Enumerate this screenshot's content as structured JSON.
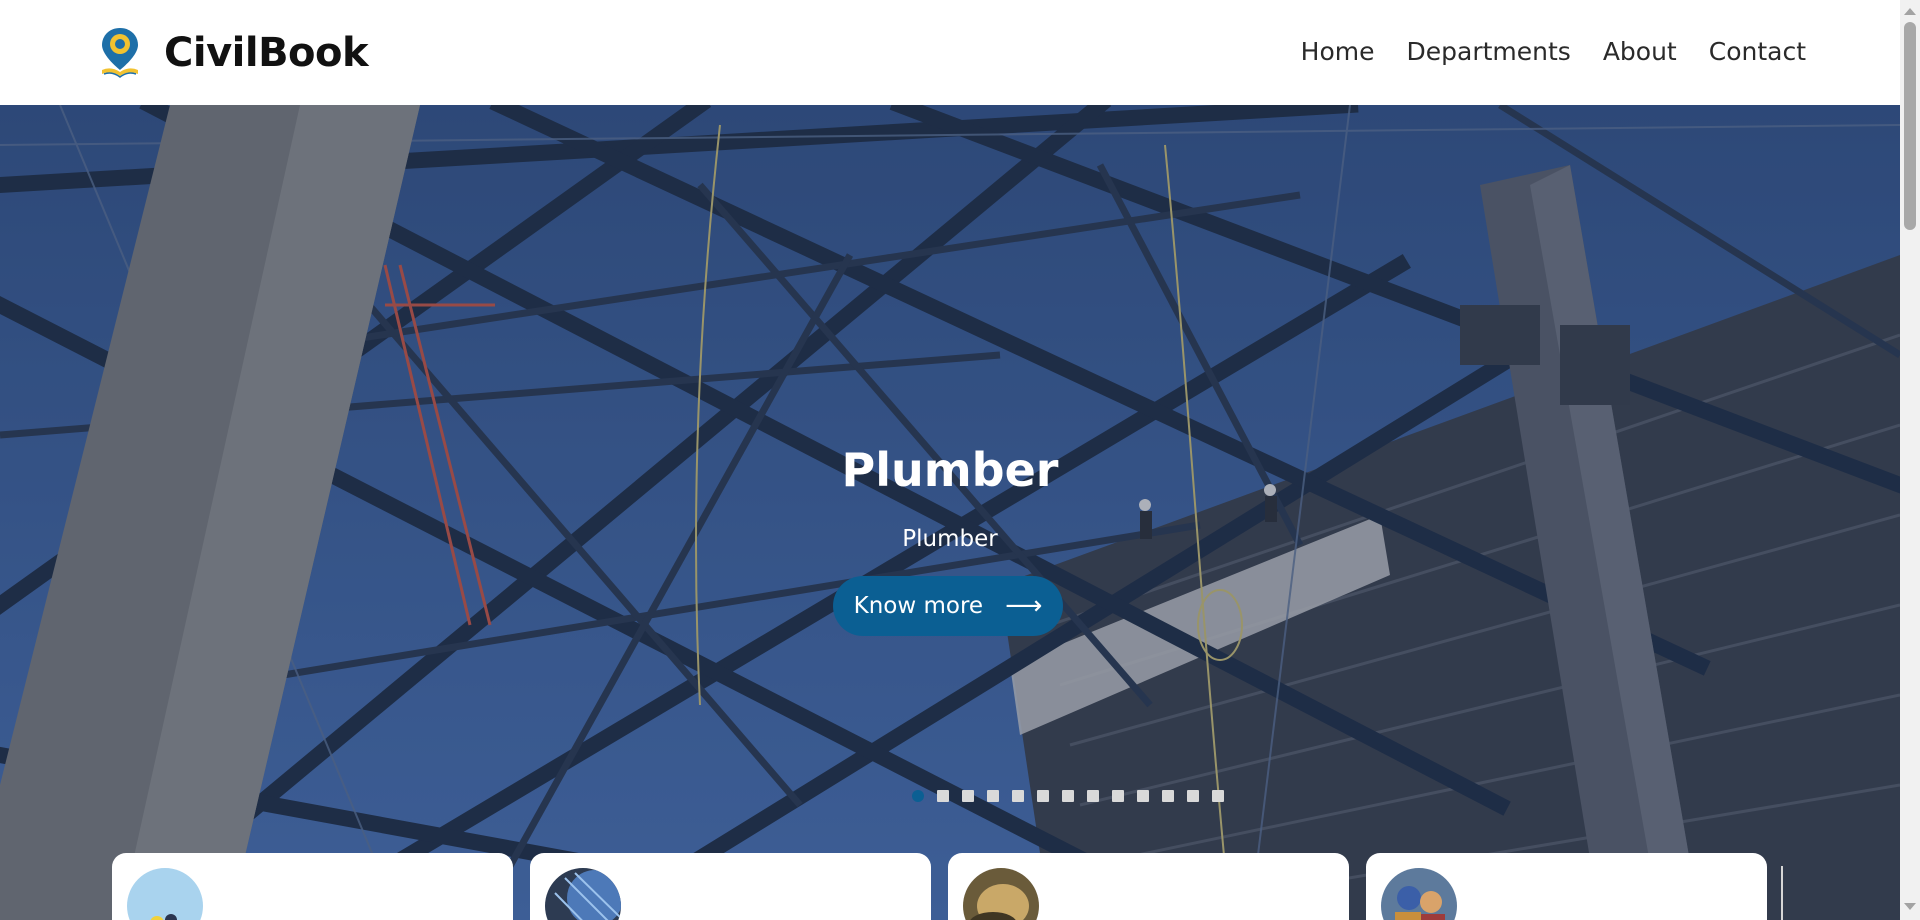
{
  "brand": {
    "name": "CivilBook",
    "logo_icon": "location-pin-book-logo"
  },
  "nav": {
    "items": [
      {
        "label": "Home"
      },
      {
        "label": "Departments"
      },
      {
        "label": "About"
      },
      {
        "label": "Contact"
      }
    ]
  },
  "hero": {
    "title": "Plumber",
    "subtitle": "Plumber",
    "cta_label": "Know more",
    "cta_arrow": "⟶",
    "slide_count": 13,
    "active_slide": 1
  },
  "colors": {
    "accent": "#0b5f93",
    "header_bg": "#ffffff",
    "hero_overlay": "#3f5a86"
  }
}
